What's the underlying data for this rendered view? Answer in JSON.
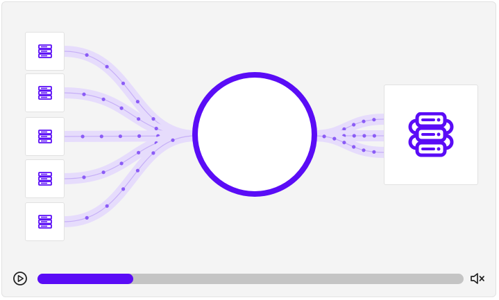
{
  "player": {
    "progress_fraction": 0.225,
    "muted": true
  },
  "icons": {
    "source": "server-stack-icon",
    "destination": "database-server-icon",
    "play": "play-icon",
    "mute": "volume-muted-icon"
  },
  "colors": {
    "accent": "#5a0cf6",
    "flow_band": "#e6dcfc",
    "flow_line": "#c6aff7",
    "flow_dot": "#8b5cf6",
    "track": "#c4c4c4",
    "background": "#f4f4f4"
  }
}
